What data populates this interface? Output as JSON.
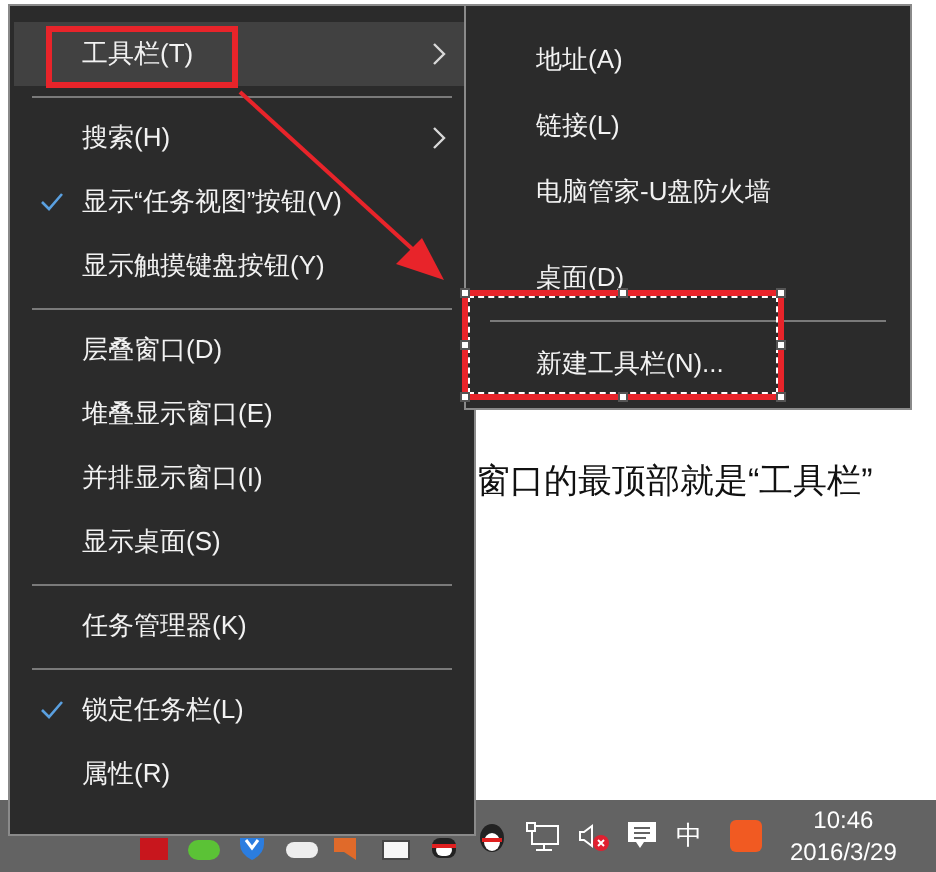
{
  "page_text": "窗口的最顶部就是“工具栏”",
  "context_menu": {
    "items": [
      {
        "kind": "item",
        "label": "工具栏(T)",
        "checked": false,
        "submenu": true,
        "highlighted": true
      },
      {
        "kind": "separator"
      },
      {
        "kind": "item",
        "label": "搜索(H)",
        "checked": false,
        "submenu": true,
        "highlighted": false
      },
      {
        "kind": "item",
        "label": "显示“任务视图”按钮(V)",
        "checked": true,
        "submenu": false,
        "highlighted": false
      },
      {
        "kind": "item",
        "label": "显示触摸键盘按钮(Y)",
        "checked": false,
        "submenu": false,
        "highlighted": false
      },
      {
        "kind": "separator"
      },
      {
        "kind": "item",
        "label": "层叠窗口(D)",
        "checked": false,
        "submenu": false,
        "highlighted": false
      },
      {
        "kind": "item",
        "label": "堆叠显示窗口(E)",
        "checked": false,
        "submenu": false,
        "highlighted": false
      },
      {
        "kind": "item",
        "label": "并排显示窗口(I)",
        "checked": false,
        "submenu": false,
        "highlighted": false
      },
      {
        "kind": "item",
        "label": "显示桌面(S)",
        "checked": false,
        "submenu": false,
        "highlighted": false
      },
      {
        "kind": "separator"
      },
      {
        "kind": "item",
        "label": "任务管理器(K)",
        "checked": false,
        "submenu": false,
        "highlighted": false
      },
      {
        "kind": "separator"
      },
      {
        "kind": "item",
        "label": "锁定任务栏(L)",
        "checked": true,
        "submenu": false,
        "highlighted": false
      },
      {
        "kind": "item",
        "label": "属性(R)",
        "checked": false,
        "submenu": false,
        "highlighted": false
      }
    ]
  },
  "toolbar_submenu": {
    "items": [
      {
        "kind": "item",
        "label": "地址(A)"
      },
      {
        "kind": "item",
        "label": "链接(L)"
      },
      {
        "kind": "item",
        "label": "电脑管家-U盘防火墙"
      },
      {
        "kind": "gap"
      },
      {
        "kind": "item",
        "label": "桌面(D)"
      },
      {
        "kind": "separator"
      },
      {
        "kind": "item",
        "label": "新建工具栏(N)..."
      }
    ]
  },
  "taskbar": {
    "ime": "中",
    "time": "10:46",
    "date": "2016/3/29"
  }
}
